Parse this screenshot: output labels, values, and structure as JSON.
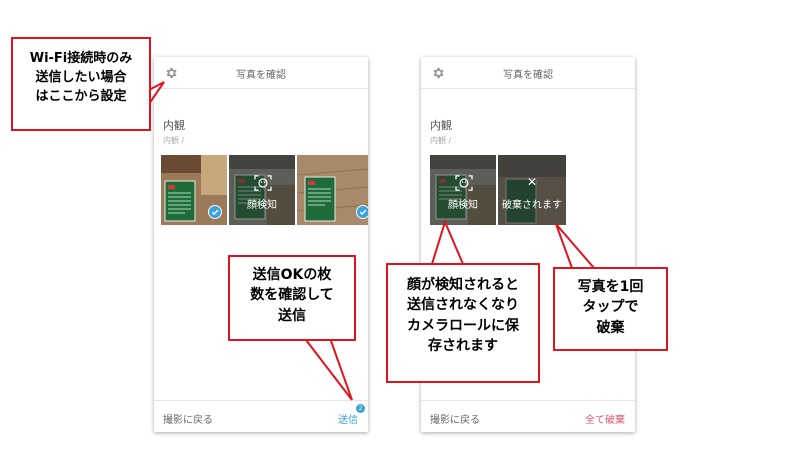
{
  "colors": {
    "accent": "#36a3d9",
    "danger": "#e8536b",
    "callout_border": "#e0141e"
  },
  "left_screen": {
    "title": "写真を確認",
    "section_title": "内観",
    "section_sub": "内観 /",
    "thumbs": [
      {
        "kind": "whiteboard-desk",
        "checked": true,
        "caption": ""
      },
      {
        "kind": "face-detected",
        "checked": false,
        "caption": "顔検知"
      },
      {
        "kind": "whiteboard-floor",
        "checked": true,
        "caption": ""
      }
    ],
    "back_label": "撮影に戻る",
    "send_label": "送信",
    "send_badge": "2"
  },
  "right_screen": {
    "title": "写真を確認",
    "section_title": "内観",
    "section_sub": "内観 /",
    "thumbs": [
      {
        "kind": "face-detected",
        "caption": "顔検知"
      },
      {
        "kind": "discarded",
        "caption": "破棄されます"
      }
    ],
    "back_label": "撮影に戻る",
    "discard_all_label": "全て破棄"
  },
  "callouts": {
    "wifi": [
      "Wi-Fi接続時のみ",
      "送信したい場合",
      "はここから設定"
    ],
    "send_ok": [
      "送信OKの枚",
      "数を確認して",
      "送信"
    ],
    "face": [
      "顔が検知されると",
      "送信されなくなり",
      "カメラロールに保",
      "存されます"
    ],
    "tap": [
      "写真を1回",
      "タップで",
      "破棄"
    ]
  }
}
